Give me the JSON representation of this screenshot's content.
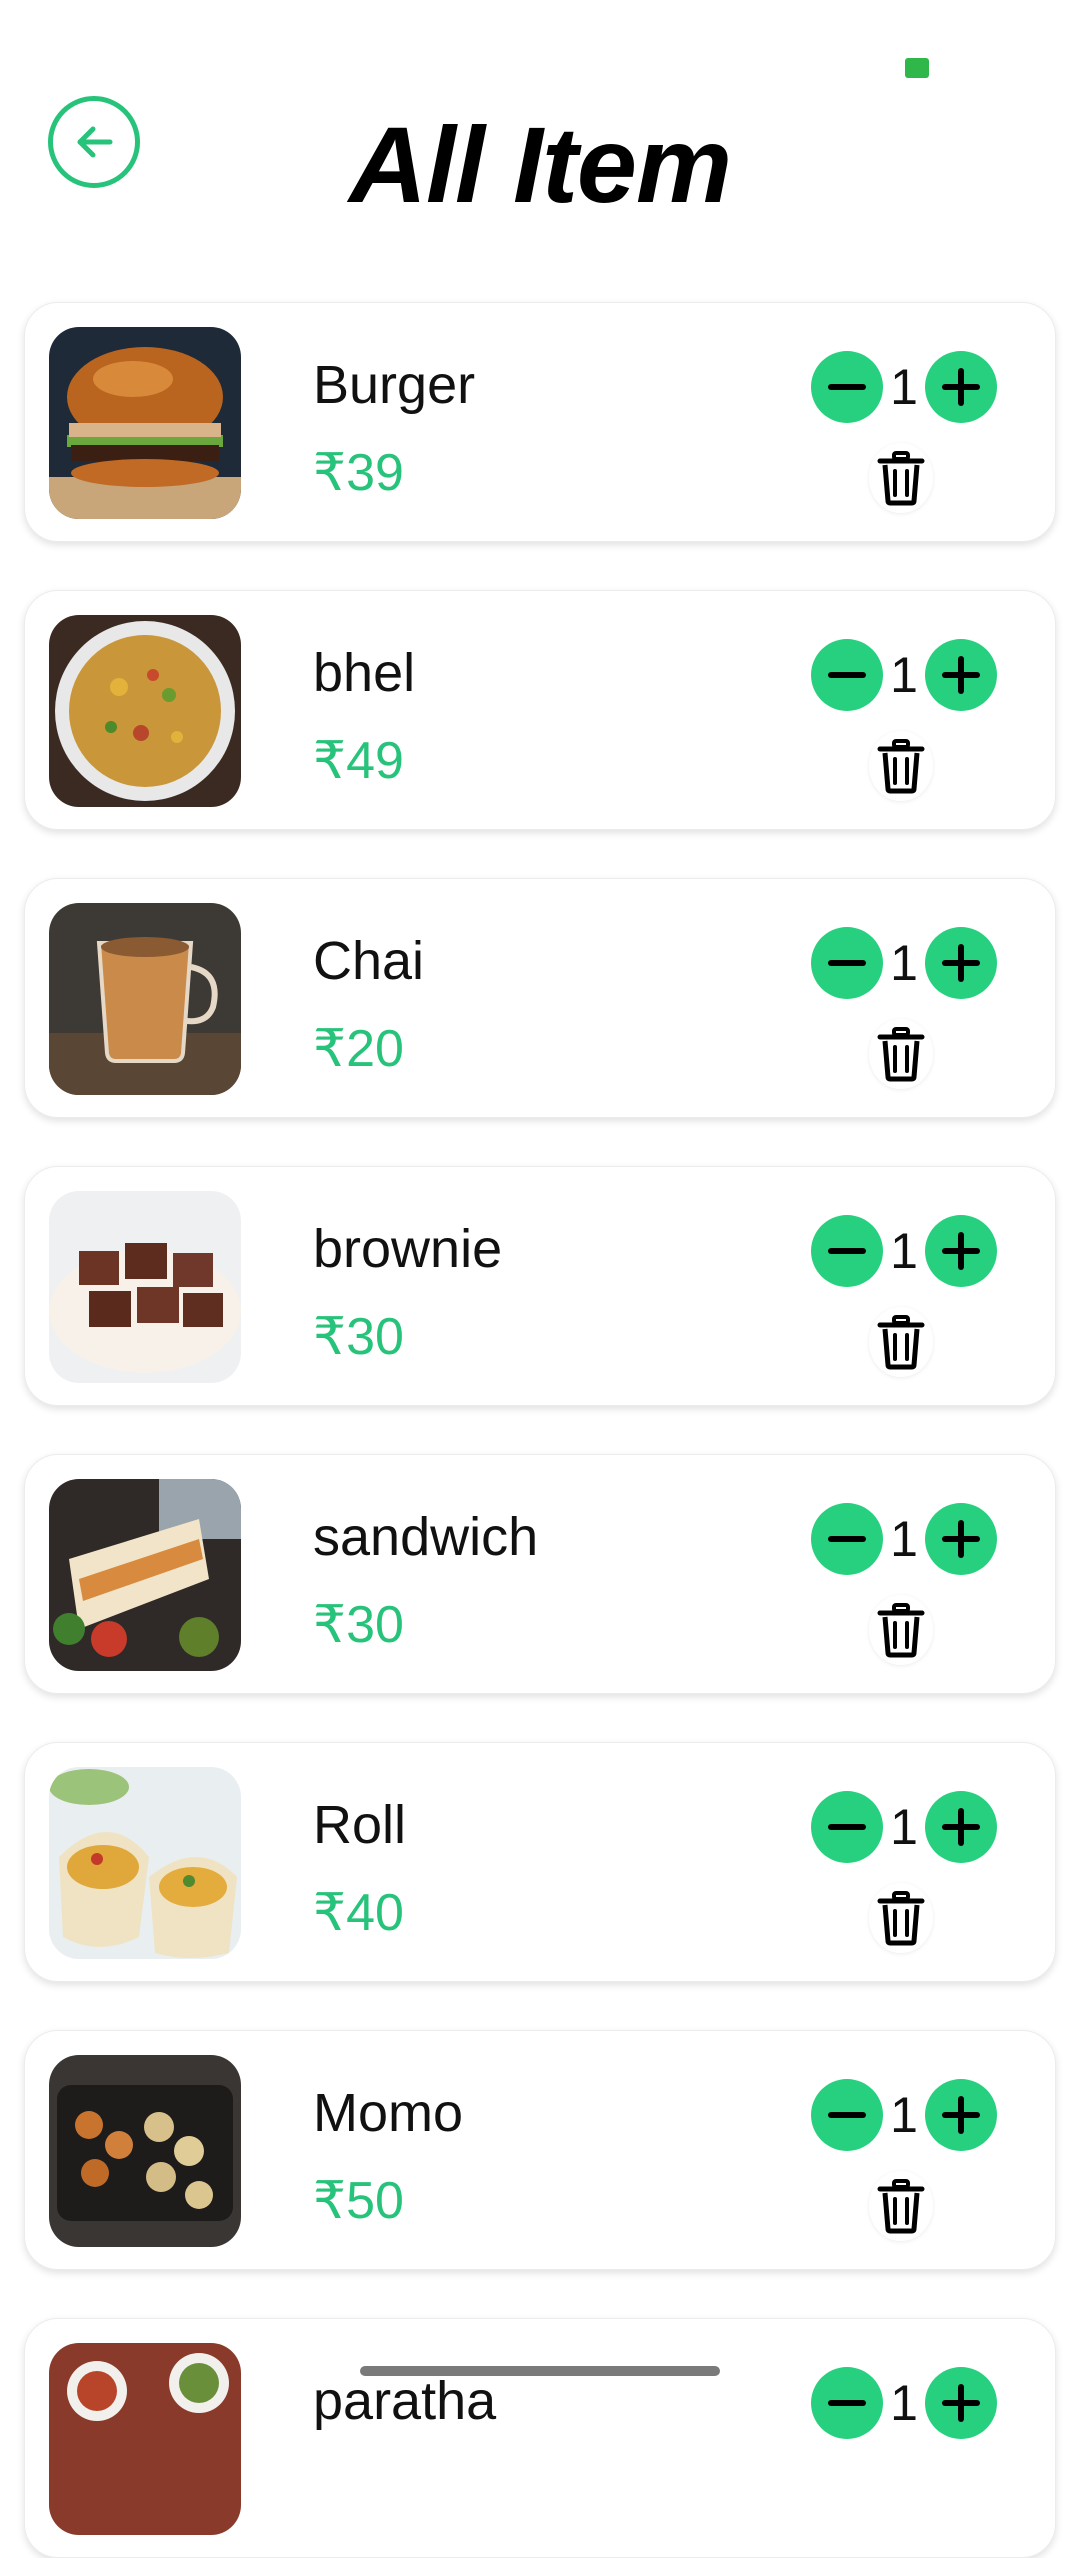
{
  "header": {
    "title": "All Item",
    "back_icon": "arrow-left-icon",
    "accent_color": "#27c37b"
  },
  "items": [
    {
      "name": "Burger",
      "price": "₹39",
      "qty": "1"
    },
    {
      "name": "bhel",
      "price": "₹49",
      "qty": "1"
    },
    {
      "name": "Chai",
      "price": "₹20",
      "qty": "1"
    },
    {
      "name": "brownie",
      "price": "₹30",
      "qty": "1"
    },
    {
      "name": "sandwich",
      "price": "₹30",
      "qty": "1"
    },
    {
      "name": "Roll",
      "price": "₹40",
      "qty": "1"
    },
    {
      "name": "Momo",
      "price": "₹50",
      "qty": "1"
    },
    {
      "name": "paratha",
      "price": "",
      "qty": "1"
    }
  ],
  "icons": {
    "minus": "minus-icon",
    "plus": "plus-icon",
    "delete": "trash-icon"
  }
}
